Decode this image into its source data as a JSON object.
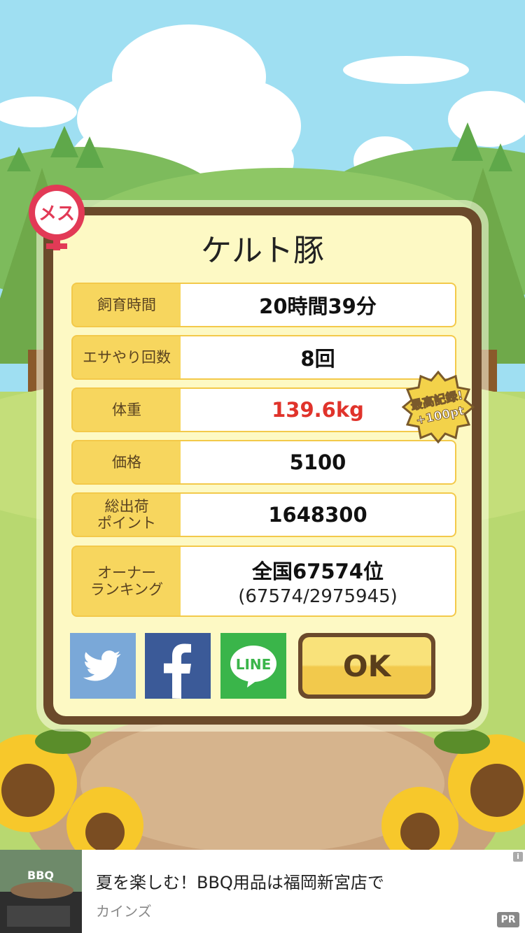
{
  "pig": {
    "name": "ケルト豚",
    "gender_label": "メス"
  },
  "stats": [
    {
      "label": "飼育時間",
      "value": "20時間39分"
    },
    {
      "label": "エサやり回数",
      "value": "8回"
    },
    {
      "label": "体重",
      "value": "139.6kg"
    },
    {
      "label": "価格",
      "value": "5100"
    },
    {
      "label": "総出荷\nポイント",
      "value": "1648300"
    },
    {
      "label": "オーナー\nランキング",
      "value": "全国67574位",
      "sub": "(67574/2975945)"
    }
  ],
  "record_badge": {
    "line1": "最高記録!",
    "line2": "+100pt"
  },
  "share": {
    "twitter_icon": "twitter-icon",
    "facebook_icon": "facebook-icon",
    "line_label": "LINE"
  },
  "ok_label": "OK",
  "ad": {
    "thumb_text": "BBQ",
    "title": "夏を楽しむ！BBQ用品は福岡新宮店で",
    "advertiser": "カインズ",
    "pr_label": "PR",
    "info_label": "i"
  },
  "colors": {
    "sky": "#9fdff2",
    "frame": "#6b4a2b",
    "panel": "#fdf9c4",
    "label_bg": "#f7d65e",
    "highlight_red": "#e0332b",
    "twitter": "#7aa8d8",
    "facebook": "#3b5a98",
    "line": "#3ab54a"
  }
}
